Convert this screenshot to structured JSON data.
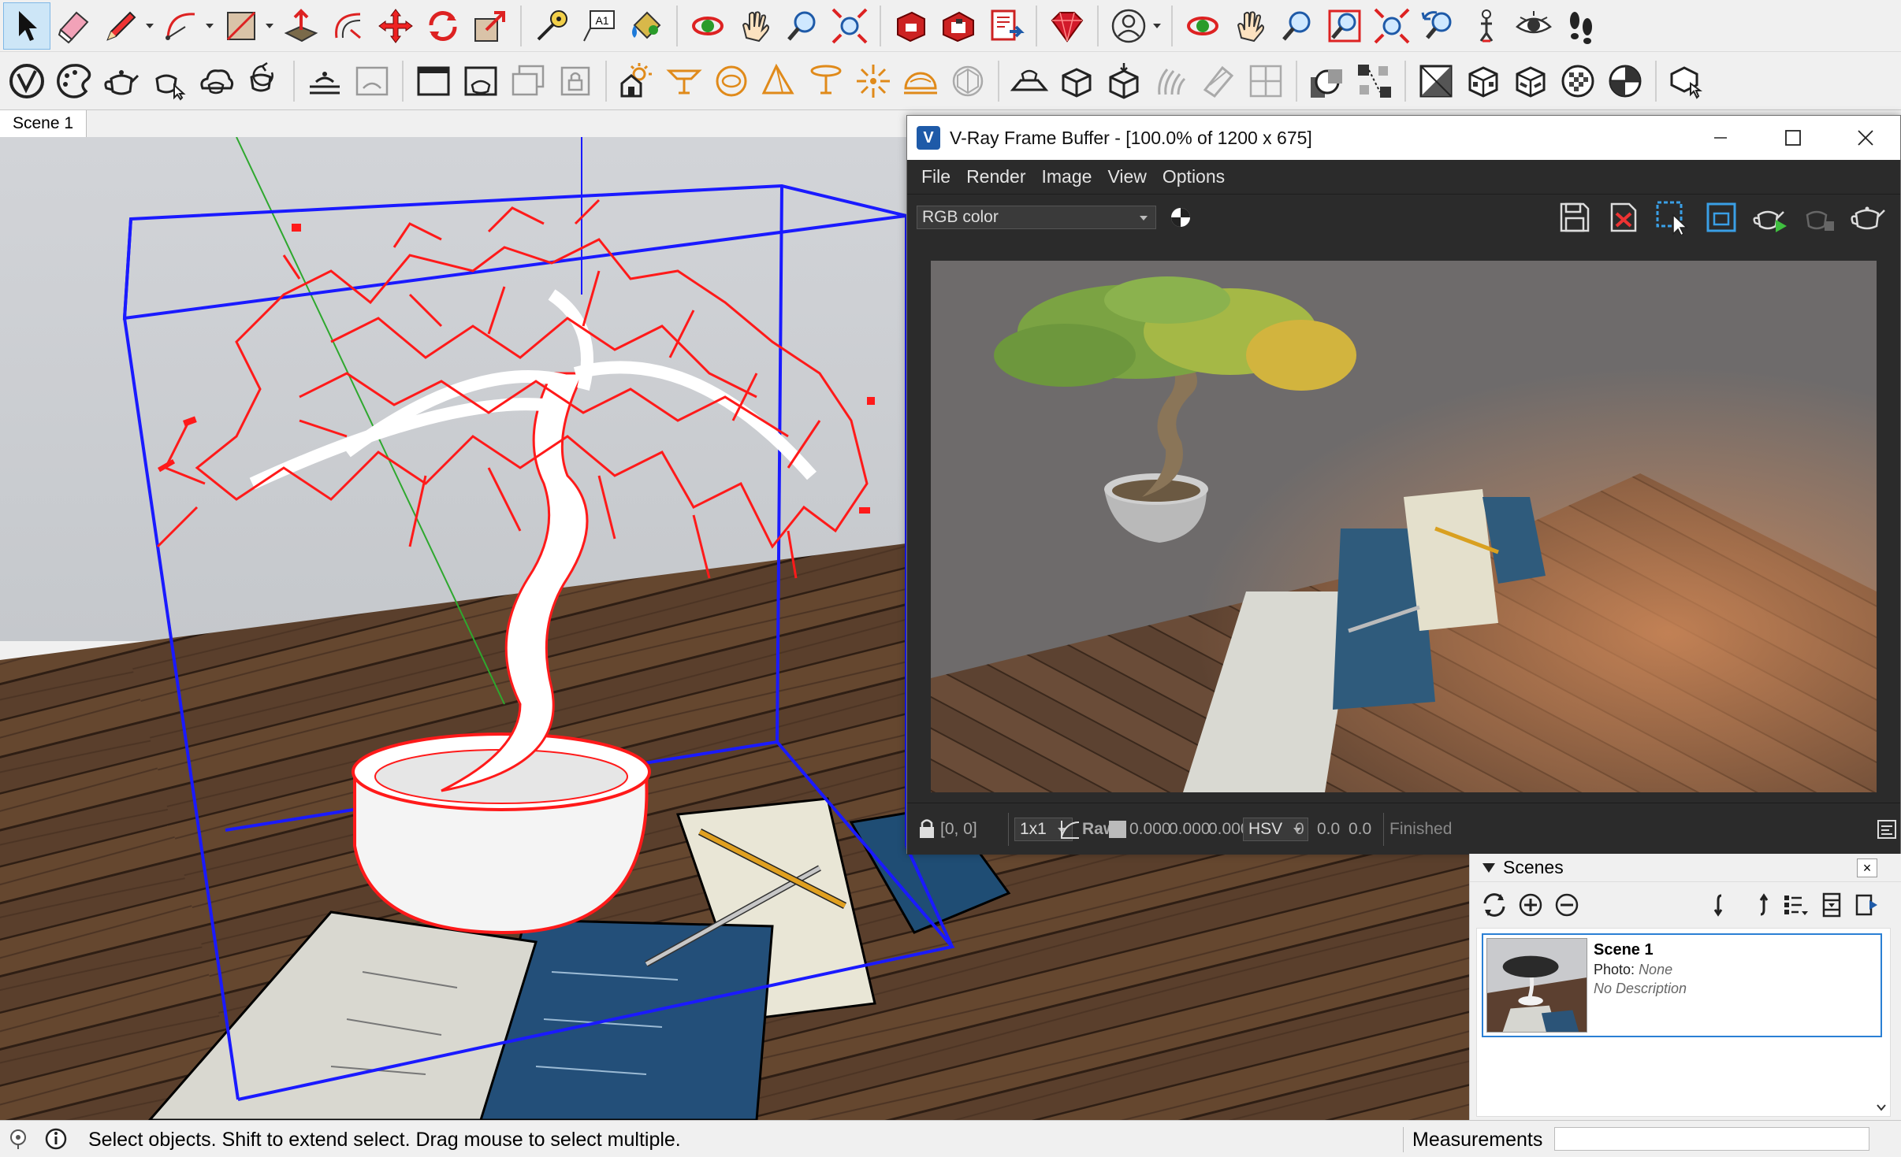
{
  "toolbar_primary": {
    "tools": [
      {
        "name": "select-icon",
        "active": true
      },
      {
        "name": "eraser-icon"
      },
      {
        "name": "line-pencil-icon",
        "dropdown": true
      },
      {
        "name": "arc-icon",
        "dropdown": true
      },
      {
        "name": "rectangle-icon",
        "dropdown": true
      },
      {
        "name": "push-pull-icon"
      },
      {
        "name": "offset-icon"
      },
      {
        "name": "move-icon"
      },
      {
        "name": "rotate-icon"
      },
      {
        "name": "scale-icon"
      },
      {
        "name": "tape-measure-icon"
      },
      {
        "name": "text-icon",
        "label": "A1"
      },
      {
        "name": "paint-bucket-icon"
      },
      {
        "name": "orbit-icon"
      },
      {
        "name": "pan-icon"
      },
      {
        "name": "zoom-icon"
      },
      {
        "name": "zoom-extents-icon"
      },
      {
        "name": "3d-warehouse-icon"
      },
      {
        "name": "extension-warehouse-icon"
      },
      {
        "name": "layout-icon"
      },
      {
        "name": "ruby-console-icon"
      },
      {
        "name": "user-account-icon",
        "dropdown": true
      },
      {
        "name": "orbit-2-icon"
      },
      {
        "name": "pan-2-icon"
      },
      {
        "name": "zoom-2-icon"
      },
      {
        "name": "zoom-window-icon"
      },
      {
        "name": "zoom-extents-2-icon"
      },
      {
        "name": "previous-view-icon"
      },
      {
        "name": "position-camera-icon"
      },
      {
        "name": "look-around-icon"
      },
      {
        "name": "walk-icon"
      }
    ]
  },
  "toolbar_vray": {
    "tools": [
      "vray-logo-icon",
      "asset-editor-icon",
      "render-teapot-icon",
      "interactive-render-icon",
      "cloud-render-icon",
      "batch-render-icon",
      "render-toggle-icon",
      "frame-buffer-icon",
      "render-region-icon",
      "render-viewport-icon",
      "render-output-icon",
      "sun-light-icon",
      "rect-light-icon",
      "sphere-light-icon",
      "spot-light-icon",
      "ies-light-icon",
      "omni-light-icon",
      "dome-light-icon",
      "mesh-light-icon",
      "infinite-plane-icon",
      "proxy-import-icon",
      "proxy-export-icon",
      "fur-icon",
      "mesh-clipper-icon",
      "scene-import-icon",
      "toggle-geometry-icon",
      "object-id-icon",
      "checker-icon",
      "material-override-icon",
      "cube-preview-icon",
      "sphere-preview-icon",
      "shading-icon",
      "vray-toolbar-icon"
    ]
  },
  "scene_tab": {
    "label": "Scene 1"
  },
  "vfb": {
    "title": "V-Ray Frame Buffer - [100.0% of 1200 x 675]",
    "menus": [
      "File",
      "Render",
      "Image",
      "View",
      "Options"
    ],
    "channel": "RGB color",
    "status": {
      "coords": "[0, 0]",
      "zoom": "1x1",
      "raw_label": "Raw",
      "rgb": [
        "0.000",
        "0.000",
        "0.000"
      ],
      "color_mode": "HSV",
      "hsv": [
        "0",
        "0.0",
        "0.0"
      ],
      "state": "Finished"
    }
  },
  "scenes_panel": {
    "title": "Scenes",
    "close": "×",
    "scene": {
      "name": "Scene 1",
      "photo_label": "Photo:",
      "photo_value": "None",
      "description": "No Description"
    }
  },
  "statusbar": {
    "text": "Select objects. Shift to extend select. Drag mouse to select multiple.",
    "measurements_label": "Measurements",
    "measurements_value": ""
  },
  "colors": {
    "selection_red": "#ff1a1a",
    "bounding_box_blue": "#1a1aff",
    "axis_green": "#2ea82e",
    "vfb_dark": "#2b2b2b",
    "accent_blue": "#2a7fd4"
  }
}
